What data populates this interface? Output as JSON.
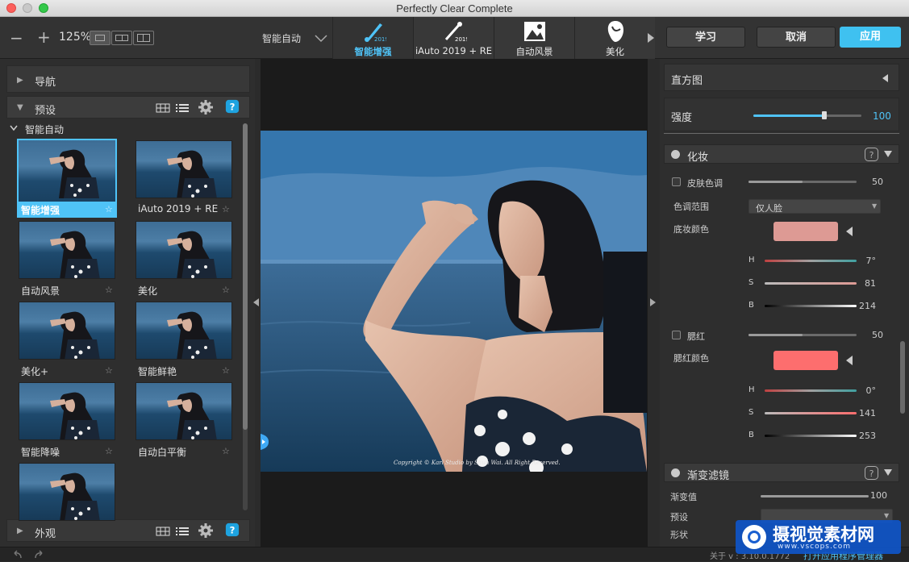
{
  "window": {
    "title": "Perfectly Clear Complete"
  },
  "toolbar": {
    "zoom_out": "−",
    "zoom_in": "+",
    "zoom_level": "125%",
    "preset_select": "智能自动",
    "modes": [
      {
        "label": "智能增强",
        "active": true,
        "icon": "brush-2019-icon"
      },
      {
        "label": "iAuto 2019 + RE",
        "active": false,
        "icon": "wand-2019-icon"
      },
      {
        "label": "自动风景",
        "active": false,
        "icon": "landscape-icon"
      },
      {
        "label": "美化",
        "active": false,
        "icon": "face-icon"
      }
    ],
    "learn": "学习",
    "cancel": "取消",
    "apply": "应用"
  },
  "left": {
    "nav_title": "导航",
    "presets_title": "预设",
    "group_title": "智能自动",
    "presets": [
      {
        "label": "智能增强",
        "selected": true
      },
      {
        "label": "iAuto 2019 + RE"
      },
      {
        "label": "自动风景"
      },
      {
        "label": "美化"
      },
      {
        "label": "美化+"
      },
      {
        "label": "智能鲜艳"
      },
      {
        "label": "智能降噪"
      },
      {
        "label": "自动白平衡"
      },
      {
        "label": ""
      }
    ],
    "appearance_title": "外观"
  },
  "image": {
    "watermark": "Copyright © Karl Studio by Shun Wai. All Right Reserved."
  },
  "right": {
    "histogram_title": "直方图",
    "strength_label": "强度",
    "strength_value": "100",
    "strength_level": 0.66,
    "makeup": {
      "title": "化妆",
      "skin_tone_label": "皮肤色调",
      "skin_tone_value": "50",
      "tone_range_label": "色调范围",
      "tone_range_value": "仅人脸",
      "foundation_label": "底妆颜色",
      "foundation_color": "#dd9a94",
      "f_h": {
        "label": "H",
        "value": "7°"
      },
      "f_s": {
        "label": "S",
        "value": "81"
      },
      "f_b": {
        "label": "B",
        "value": "214"
      },
      "blush_label": "腮红",
      "blush_value": "50",
      "blush_color_label": "腮红颜色",
      "blush_color": "#fd6e6e",
      "b_h": {
        "label": "H",
        "value": "0°"
      },
      "b_s": {
        "label": "S",
        "value": "141"
      },
      "b_b": {
        "label": "B",
        "value": "253"
      }
    },
    "gradient": {
      "title": "渐变滤镜",
      "value_label": "渐变值",
      "value": "100",
      "preset_label": "预设",
      "shape_label": "形状"
    }
  },
  "status": {
    "about": "关于 v : 3.10.0.1772",
    "open_manager": "打开应用程序管理器",
    "logo_text": "摄视觉素材网",
    "logo_url": "www.vscops.com"
  },
  "colors": {
    "accent": "#4fc3f7",
    "apply": "#3fc1f0"
  }
}
